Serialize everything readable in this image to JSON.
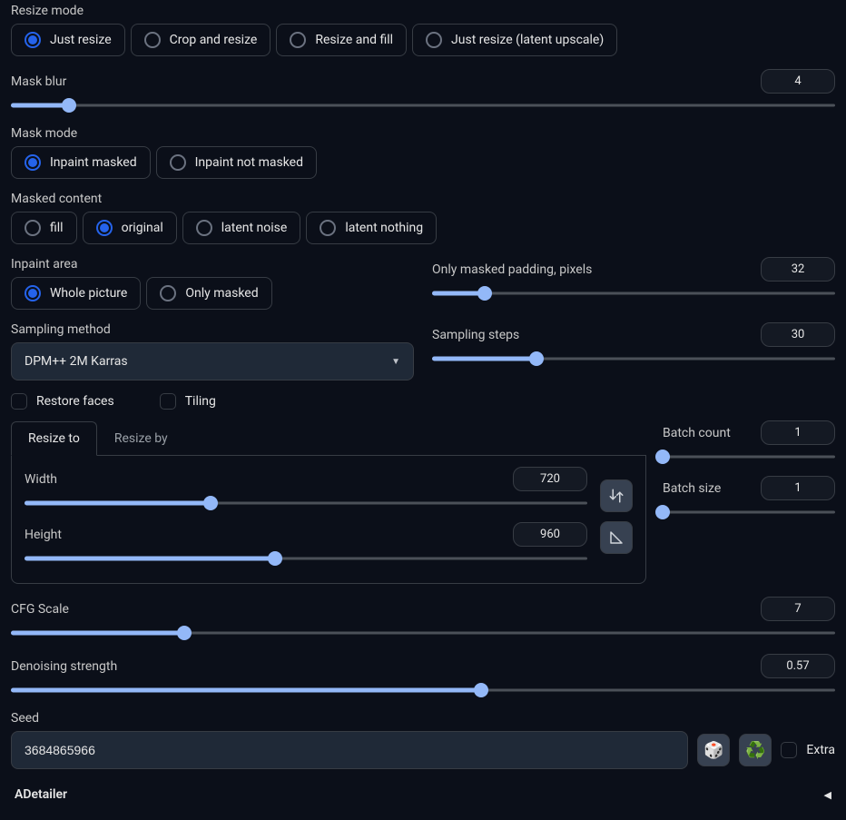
{
  "resize_mode": {
    "label": "Resize mode",
    "options": [
      "Just resize",
      "Crop and resize",
      "Resize and fill",
      "Just resize (latent upscale)"
    ],
    "selected": 0
  },
  "mask_blur": {
    "label": "Mask blur",
    "value": 4,
    "percent": 7
  },
  "mask_mode": {
    "label": "Mask mode",
    "options": [
      "Inpaint masked",
      "Inpaint not masked"
    ],
    "selected": 0
  },
  "masked_content": {
    "label": "Masked content",
    "options": [
      "fill",
      "original",
      "latent noise",
      "latent nothing"
    ],
    "selected": 1
  },
  "inpaint_area": {
    "label": "Inpaint area",
    "options": [
      "Whole picture",
      "Only masked"
    ],
    "selected": 0
  },
  "only_masked_padding": {
    "label": "Only masked padding, pixels",
    "value": 32,
    "percent": 13
  },
  "sampling_method": {
    "label": "Sampling method",
    "value": "DPM++ 2M Karras"
  },
  "sampling_steps": {
    "label": "Sampling steps",
    "value": 30,
    "percent": 26
  },
  "restore_faces": {
    "label": "Restore faces",
    "checked": false
  },
  "tiling": {
    "label": "Tiling",
    "checked": false
  },
  "tabs": {
    "options": [
      "Resize to",
      "Resize by"
    ],
    "selected": 0
  },
  "width": {
    "label": "Width",
    "value": 720,
    "percent": 33
  },
  "height": {
    "label": "Height",
    "value": 960,
    "percent": 44.5
  },
  "batch_count": {
    "label": "Batch count",
    "value": 1,
    "percent": 0
  },
  "batch_size": {
    "label": "Batch size",
    "value": 1,
    "percent": 0
  },
  "cfg_scale": {
    "label": "CFG Scale",
    "value": 7,
    "percent": 21
  },
  "denoising": {
    "label": "Denoising strength",
    "value": "0.57",
    "percent": 57
  },
  "seed": {
    "label": "Seed",
    "value": "3684865966",
    "extra_label": "Extra",
    "extra_checked": false
  },
  "adetailer": {
    "title": "ADetailer"
  }
}
